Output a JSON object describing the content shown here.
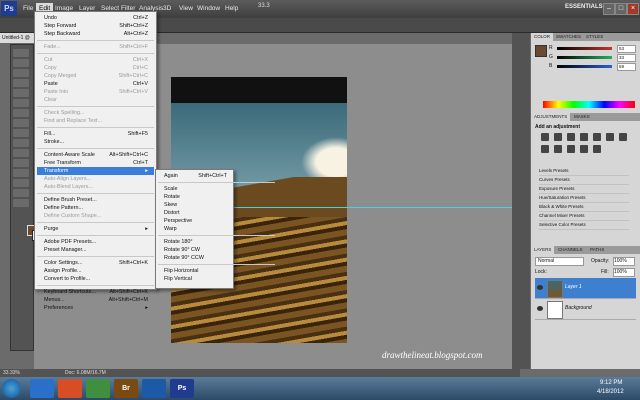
{
  "app": {
    "logo": "Ps",
    "menus": [
      "File",
      "Edit",
      "Image",
      "Layer",
      "Select",
      "Filter",
      "Analysis",
      "3D",
      "View",
      "Window",
      "Help"
    ],
    "active_menu": "Edit",
    "zoom": "33.3",
    "workspace": "ESSENTIALS",
    "window_controls": [
      "–",
      "□",
      "×"
    ]
  },
  "document": {
    "tab_label": "Untitled-1 @",
    "status_zoom": "33.33%",
    "status_doc": "Doc: 6.08M/16.7M",
    "watermark": "drawthelineat.blogspot.com"
  },
  "edit_menu": {
    "items": [
      {
        "label": "Undo",
        "shortcut": "Ctrl+Z",
        "disabled": false
      },
      {
        "label": "Step Forward",
        "shortcut": "Shift+Ctrl+Z",
        "disabled": false
      },
      {
        "label": "Step Backward",
        "shortcut": "Alt+Ctrl+Z",
        "disabled": false
      },
      {
        "sep": true
      },
      {
        "label": "Fade...",
        "shortcut": "Shift+Ctrl+F",
        "disabled": true
      },
      {
        "sep": true
      },
      {
        "label": "Cut",
        "shortcut": "Ctrl+X",
        "disabled": true
      },
      {
        "label": "Copy",
        "shortcut": "Ctrl+C",
        "disabled": true
      },
      {
        "label": "Copy Merged",
        "shortcut": "Shift+Ctrl+C",
        "disabled": true
      },
      {
        "label": "Paste",
        "shortcut": "Ctrl+V",
        "disabled": false
      },
      {
        "label": "Paste Into",
        "shortcut": "Shift+Ctrl+V",
        "disabled": true
      },
      {
        "label": "Clear",
        "shortcut": "",
        "disabled": true
      },
      {
        "sep": true
      },
      {
        "label": "Check Spelling...",
        "shortcut": "",
        "disabled": true
      },
      {
        "label": "Find and Replace Text...",
        "shortcut": "",
        "disabled": true
      },
      {
        "sep": true
      },
      {
        "label": "Fill...",
        "shortcut": "Shift+F5",
        "disabled": false
      },
      {
        "label": "Stroke...",
        "shortcut": "",
        "disabled": false
      },
      {
        "sep": true
      },
      {
        "label": "Content-Aware Scale",
        "shortcut": "Alt+Shift+Ctrl+C",
        "disabled": false
      },
      {
        "label": "Free Transform",
        "shortcut": "Ctrl+T",
        "disabled": false
      },
      {
        "label": "Transform",
        "shortcut": "",
        "disabled": false,
        "highlight": true,
        "submenu": true
      },
      {
        "label": "Auto-Align Layers...",
        "shortcut": "",
        "disabled": true
      },
      {
        "label": "Auto-Blend Layers...",
        "shortcut": "",
        "disabled": true
      },
      {
        "sep": true
      },
      {
        "label": "Define Brush Preset...",
        "shortcut": "",
        "disabled": false
      },
      {
        "label": "Define Pattern...",
        "shortcut": "",
        "disabled": false
      },
      {
        "label": "Define Custom Shape...",
        "shortcut": "",
        "disabled": true
      },
      {
        "sep": true
      },
      {
        "label": "Purge",
        "shortcut": "",
        "disabled": false,
        "submenu": true
      },
      {
        "sep": true
      },
      {
        "label": "Adobe PDF Presets...",
        "shortcut": "",
        "disabled": false
      },
      {
        "label": "Preset Manager...",
        "shortcut": "",
        "disabled": false
      },
      {
        "sep": true
      },
      {
        "label": "Color Settings...",
        "shortcut": "Shift+Ctrl+K",
        "disabled": false
      },
      {
        "label": "Assign Profile...",
        "shortcut": "",
        "disabled": false
      },
      {
        "label": "Convert to Profile...",
        "shortcut": "",
        "disabled": false
      },
      {
        "sep": true
      },
      {
        "label": "Keyboard Shortcuts...",
        "shortcut": "Alt+Shift+Ctrl+K",
        "disabled": false
      },
      {
        "label": "Menus...",
        "shortcut": "Alt+Shift+Ctrl+M",
        "disabled": false
      },
      {
        "label": "Preferences",
        "shortcut": "",
        "disabled": false,
        "submenu": true
      }
    ]
  },
  "transform_menu": {
    "items": [
      {
        "label": "Again",
        "shortcut": "Shift+Ctrl+T",
        "disabled": true
      },
      {
        "sep": true
      },
      {
        "label": "Scale",
        "shortcut": "",
        "disabled": false,
        "highlight": true
      },
      {
        "label": "Rotate",
        "shortcut": "",
        "disabled": false
      },
      {
        "label": "Skew",
        "shortcut": "",
        "disabled": false
      },
      {
        "label": "Distort",
        "shortcut": "",
        "disabled": false
      },
      {
        "label": "Perspective",
        "shortcut": "",
        "disabled": false
      },
      {
        "label": "Warp",
        "shortcut": "",
        "disabled": false
      },
      {
        "sep": true
      },
      {
        "label": "Rotate 180°",
        "shortcut": "",
        "disabled": false
      },
      {
        "label": "Rotate 90° CW",
        "shortcut": "",
        "disabled": false
      },
      {
        "label": "Rotate 90° CCW",
        "shortcut": "",
        "disabled": false
      },
      {
        "sep": true
      },
      {
        "label": "Flip Horizontal",
        "shortcut": "",
        "disabled": false
      },
      {
        "label": "Flip Vertical",
        "shortcut": "",
        "disabled": false
      }
    ]
  },
  "color_panel": {
    "tabs": [
      "COLOR",
      "SWATCHES",
      "STYLES"
    ],
    "channels": [
      {
        "name": "R",
        "value": "53",
        "color": "#c0392b"
      },
      {
        "name": "G",
        "value": "33",
        "color": "#27ae60"
      },
      {
        "name": "B",
        "value": "59",
        "color": "#2e5fd1"
      }
    ]
  },
  "adjustments_panel": {
    "tabs": [
      "ADJUSTMENTS",
      "MASKS"
    ],
    "title": "Add an adjustment",
    "presets": [
      "Levels Presets",
      "Curves Presets",
      "Exposure Presets",
      "Hue/Saturation Presets",
      "Black & White Presets",
      "Channel Mixer Presets",
      "Selective Color Presets"
    ]
  },
  "layers_panel": {
    "tabs": [
      "LAYERS",
      "CHANNELS",
      "PATHS"
    ],
    "blend_mode": "Normal",
    "opacity_label": "Opacity:",
    "opacity": "100%",
    "lock_label": "Lock:",
    "fill_label": "Fill:",
    "fill": "100%",
    "layers": [
      {
        "name": "Layer 1",
        "selected": true
      },
      {
        "name": "Background",
        "selected": false
      }
    ]
  },
  "taskbar": {
    "apps": [
      "",
      "",
      "",
      "Br",
      "",
      "Ps"
    ],
    "time": "9:12 PM",
    "date": "4/18/2012"
  }
}
